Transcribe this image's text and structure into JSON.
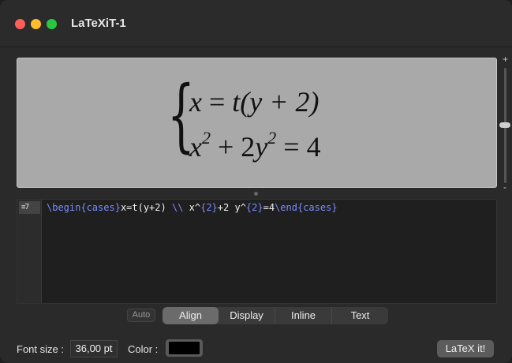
{
  "window": {
    "title": "LaTeXiT-1"
  },
  "preview": {
    "lines": [
      {
        "lhs": "x",
        "op": " = ",
        "rhs": "t(y + 2)"
      },
      {
        "a": "x",
        "a_exp": "2",
        "mid": " + 2",
        "b": "y",
        "b_exp": "2",
        "op": " = ",
        "rhs": "4"
      }
    ]
  },
  "zoom_slider": {
    "plus_label": "+",
    "minus_label": "-"
  },
  "editor": {
    "line_number": "7",
    "tokens": [
      {
        "text": "\\begin",
        "kind": "cmd"
      },
      {
        "text": "{cases}",
        "kind": "arg"
      },
      {
        "text": "x=t(y+2) ",
        "kind": "plain"
      },
      {
        "text": "\\\\",
        "kind": "cmd"
      },
      {
        "text": " x^",
        "kind": "plain"
      },
      {
        "text": "{2}",
        "kind": "arg"
      },
      {
        "text": "+2 y^",
        "kind": "plain"
      },
      {
        "text": "{2}",
        "kind": "arg"
      },
      {
        "text": "=4",
        "kind": "plain"
      },
      {
        "text": "\\end",
        "kind": "cmd"
      },
      {
        "text": "{cases}",
        "kind": "arg"
      }
    ]
  },
  "modes": {
    "auto_label": "Auto",
    "items": [
      "Align",
      "Display",
      "Inline",
      "Text"
    ],
    "selected": "Align"
  },
  "bottom": {
    "font_size_label": "Font size :",
    "font_size_value": "36,00 pt",
    "color_label": "Color :",
    "color_value": "#000000",
    "latex_button": "LaTeX it!"
  }
}
